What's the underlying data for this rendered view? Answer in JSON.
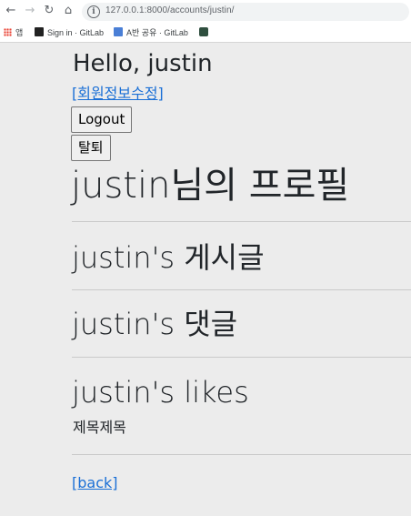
{
  "browser": {
    "url": "127.0.0.1:8000/accounts/justin/",
    "bookmarks": [
      {
        "label": "앱"
      },
      {
        "label": "Sign in · GitLab"
      },
      {
        "label": "A반 공유 · GitLab"
      },
      {
        "label": ""
      }
    ]
  },
  "page": {
    "greeting": "Hello, justin",
    "edit_profile_link": "[회원정보수정]",
    "logout_button": "Logout",
    "withdraw_button": "탈퇴",
    "profile_title": "justin님의 프로필",
    "sections": {
      "posts_title": "justin's 게시글",
      "comments_title": "justin's 댓글",
      "likes_title": "justin's likes",
      "liked_items": [
        "제목제목"
      ]
    },
    "back_link": "[back]"
  }
}
